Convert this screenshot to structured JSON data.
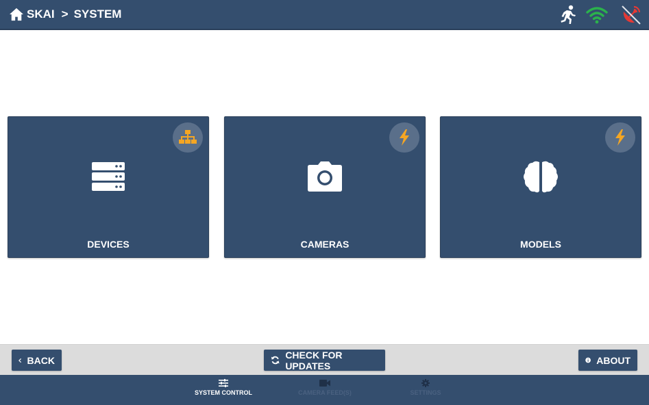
{
  "header": {
    "breadcrumb": [
      "SKAI",
      "SYSTEM"
    ],
    "separator": ">",
    "icons": [
      "running-person-icon",
      "wifi-icon",
      "satellite-dish-icon"
    ],
    "colors": {
      "bar": "#344e6e",
      "wifi": "#2bb24c",
      "satellite": "#e53935"
    }
  },
  "cards": [
    {
      "label": "DEVICES",
      "icon": "server-icon",
      "badge_icon": "network-hierarchy-icon"
    },
    {
      "label": "CAMERAS",
      "icon": "camera-icon",
      "badge_icon": "lightning-bolt-icon"
    },
    {
      "label": "MODELS",
      "icon": "brain-icon",
      "badge_icon": "lightning-bolt-icon"
    }
  ],
  "accent": "#f5a623",
  "toolbar": {
    "back_label": "BACK",
    "update_label": "CHECK FOR UPDATES",
    "about_label": "ABOUT"
  },
  "bottom_nav": {
    "items": [
      {
        "label": "SYSTEM CONTROL",
        "icon": "sliders-icon",
        "active": true
      },
      {
        "label": "CAMERA FEED(S)",
        "icon": "video-camera-icon",
        "active": false
      },
      {
        "label": "SETTINGS",
        "icon": "gear-icon",
        "active": false
      }
    ]
  }
}
